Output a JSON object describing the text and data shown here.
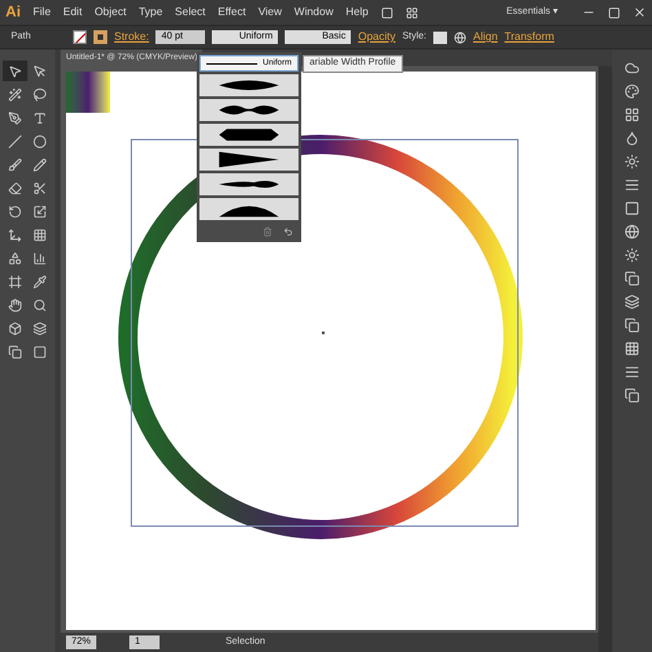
{
  "app": {
    "logo": "Ai",
    "menus": [
      "File",
      "Edit",
      "Object",
      "Type",
      "Select",
      "Effect",
      "View",
      "Window",
      "Help"
    ],
    "workspace": "Essentials ▾"
  },
  "control_bar": {
    "selection": "Path",
    "stroke_label": "Stroke:",
    "stroke_weight": "40 pt",
    "profile": "Uniform",
    "brush": "Basic",
    "opacity_label": "Opacity",
    "style_label": "Style:",
    "align_label": "Align",
    "transform_label": "Transform"
  },
  "document_tab": {
    "title": "Untitled-1* @ 72% (CMYK/Preview)"
  },
  "profile_menu": {
    "items": [
      {
        "kind": "uniform",
        "label": "Uniform",
        "selected": true
      },
      {
        "kind": "profile",
        "selected": false
      },
      {
        "kind": "profile",
        "selected": false
      },
      {
        "kind": "profile",
        "selected": false
      },
      {
        "kind": "profile",
        "selected": false
      },
      {
        "kind": "profile",
        "selected": false
      },
      {
        "kind": "profile",
        "selected": false
      }
    ],
    "tooltip": "ariable Width Profile"
  },
  "tools": [
    {
      "selected": true
    },
    {
      "selected": false
    },
    {
      "selected": false
    },
    {
      "selected": false
    },
    {
      "selected": false
    },
    {
      "selected": false
    },
    {
      "selected": false
    },
    {
      "selected": false
    },
    {
      "selected": false
    },
    {
      "selected": false
    },
    {
      "selected": false
    },
    {
      "selected": false
    },
    {
      "selected": false
    },
    {
      "selected": false
    },
    {
      "selected": false
    },
    {
      "selected": false
    },
    {
      "selected": false
    },
    {
      "selected": false
    },
    {
      "selected": false
    },
    {
      "selected": false
    },
    {
      "selected": false
    },
    {
      "selected": false
    },
    {
      "selected": false
    },
    {
      "selected": false
    },
    {
      "selected": false
    },
    {
      "selected": false
    }
  ],
  "status_bar": {
    "zoom": "72%",
    "page": "1",
    "tool": "Selection"
  }
}
